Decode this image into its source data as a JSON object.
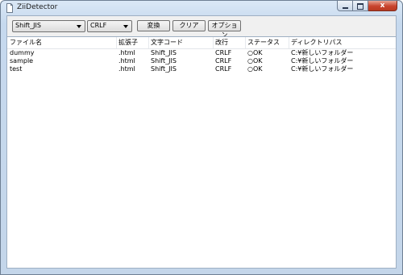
{
  "window": {
    "title": "ZiiDetector",
    "icon": "file-icon",
    "close_label": "x"
  },
  "toolbar": {
    "encoding": "Shift_JIS",
    "newline": "CRLF",
    "convert_label": "変換",
    "clear_label": "クリア",
    "options_label": "オプション"
  },
  "table": {
    "columns": [
      "ファイル名",
      "拡張子",
      "文字コード",
      "改行",
      "ステータス",
      "ディレクトリパス"
    ],
    "rows": [
      [
        "dummy",
        ".html",
        "Shift_JIS",
        "CRLF",
        "○OK",
        "C:¥新しいフォルダー"
      ],
      [
        "sample",
        ".html",
        "Shift_JIS",
        "CRLF",
        "○OK",
        "C:¥新しいフォルダー"
      ],
      [
        "test",
        ".html",
        "Shift_JIS",
        "CRLF",
        "○OK",
        "C:¥新しいフォルダー"
      ]
    ]
  }
}
